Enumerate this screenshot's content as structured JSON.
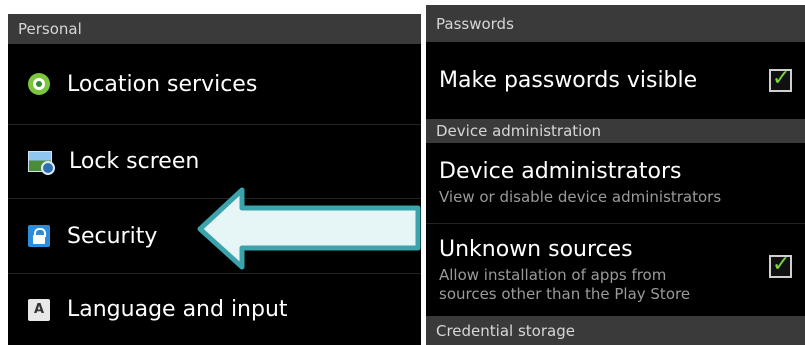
{
  "left_panel": {
    "section_header": "Personal",
    "items": [
      {
        "label": "Location services",
        "icon": "location-icon"
      },
      {
        "label": "Lock screen",
        "icon": "lock-screen-icon"
      },
      {
        "label": "Security",
        "icon": "security-lock-icon"
      },
      {
        "label": "Language and input",
        "icon": "language-icon",
        "icon_glyph": "A"
      }
    ]
  },
  "right_panel": {
    "sections": [
      {
        "header": "Passwords"
      },
      {
        "header": "Device administration"
      },
      {
        "header": "Credential storage"
      }
    ],
    "settings": [
      {
        "title": "Make passwords visible",
        "checked": true
      },
      {
        "title": "Device administrators",
        "subtitle": "View or disable device administrators"
      },
      {
        "title": "Unknown sources",
        "subtitle": "Allow installation of apps from sources other than the Play Store",
        "checked": true
      }
    ]
  },
  "colors": {
    "arrow_fill": "#e6f6f6",
    "arrow_stroke": "#3aa3ab",
    "checkmark": "#7cd63b",
    "header_bg": "#3a3a3a"
  }
}
